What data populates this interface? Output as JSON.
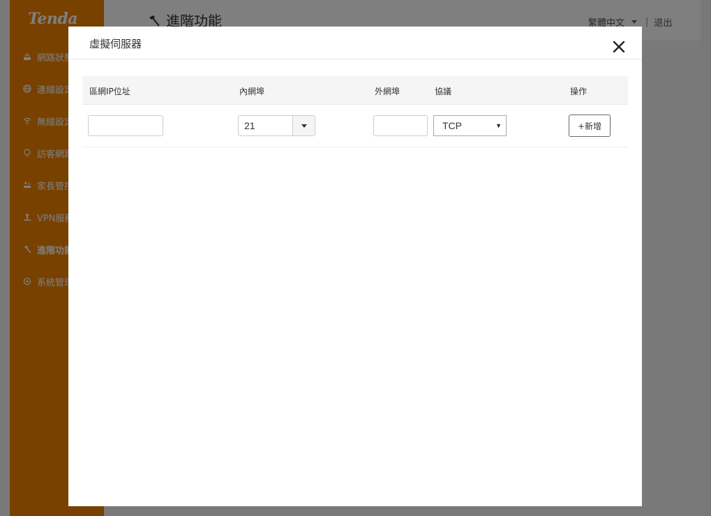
{
  "app": {
    "logo": "Tenda",
    "page_title": "進階功能",
    "language": "繁體中文",
    "separator": "|",
    "logout": "退出"
  },
  "sidebar": {
    "items": [
      {
        "label": "網路狀態",
        "icon": "network-status-icon"
      },
      {
        "label": "連線設定",
        "icon": "globe-icon"
      },
      {
        "label": "無線設定",
        "icon": "wifi-icon"
      },
      {
        "label": "訪客網路",
        "icon": "guest-network-icon"
      },
      {
        "label": "家長管控",
        "icon": "parental-control-icon"
      },
      {
        "label": "VPN服務",
        "icon": "vpn-icon"
      },
      {
        "label": "進階功能",
        "icon": "hammer-icon",
        "active": true
      },
      {
        "label": "系統管理",
        "icon": "gear-icon"
      }
    ]
  },
  "modal": {
    "title": "虛擬伺服器",
    "close_icon": "close-icon",
    "table": {
      "headers": {
        "lan_ip": "區網IP位址",
        "internal_port": "內網埠",
        "external_port": "外網埠",
        "protocol": "協議",
        "action": "操作"
      },
      "row": {
        "lan_ip_value": "",
        "internal_port_value": "21",
        "external_port_value": "",
        "protocol_value": "TCP",
        "add_label": "+新增"
      }
    }
  },
  "colors": {
    "sidebar": "#f08300",
    "overlay": "rgba(0,0,0,0.5)"
  }
}
